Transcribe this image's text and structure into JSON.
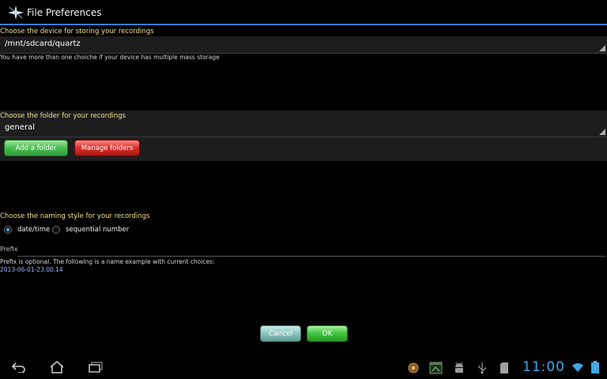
{
  "window": {
    "title": "File Preferences"
  },
  "storage": {
    "label": "Choose the device for storing your recordings",
    "device": "/mnt/sdcard/quartz",
    "hint": "You have more than one choiche if your device has multiple mass storage"
  },
  "folder": {
    "label": "Choose the folder for your recordings",
    "selected": "general",
    "add_button": "Add a folder",
    "manage_button": "Manage folders"
  },
  "naming": {
    "label": "Choose the naming style for your recordings",
    "options": [
      {
        "label": "date/time",
        "checked": true
      },
      {
        "label": "sequential number",
        "checked": false
      }
    ]
  },
  "prefix": {
    "label": "Prefix",
    "value": "",
    "hint": "Prefix is optional. The following is a name example with current choices:",
    "example": "2013-06-01-23.00.14"
  },
  "dialog": {
    "cancel_label": "Cancel",
    "ok_label": "OK"
  },
  "status_bar": {
    "clock": "11:00",
    "icons": [
      "back-icon",
      "home-icon",
      "recent-apps-icon",
      "recorder-notification-icon",
      "screenshot-icon",
      "android-debug-icon",
      "usb-icon",
      "sd-card-icon",
      "wifi-icon",
      "battery-icon"
    ]
  },
  "colors": {
    "accent": "#3a7bd5",
    "section_label": "#f0e08a",
    "clock": "#3fa7e3",
    "add_button": "#4fbf54",
    "manage_button": "#e0332e"
  }
}
